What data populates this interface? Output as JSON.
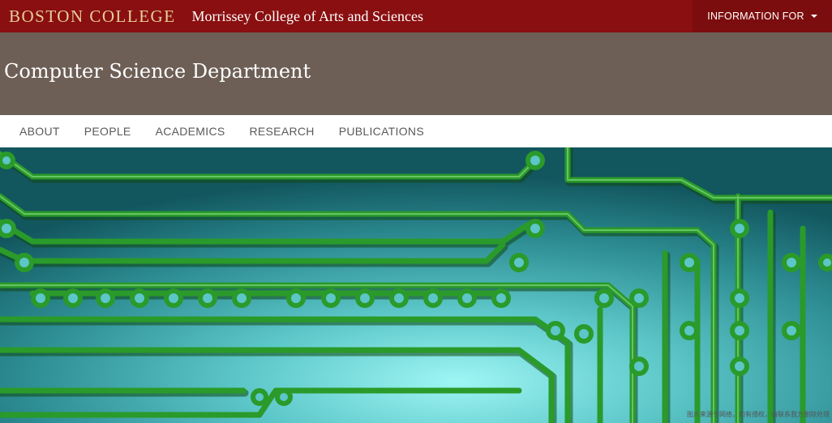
{
  "header": {
    "logo_text": "BOSTON COLLEGE",
    "college_name": "Morrissey College of Arts and Sciences",
    "info_for_label": "INFORMATION FOR"
  },
  "banner": {
    "title": "Computer Science Department"
  },
  "nav": {
    "items": [
      "ABOUT",
      "PEOPLE",
      "ACADEMICS",
      "RESEARCH",
      "PUBLICATIONS"
    ]
  },
  "hero": {
    "caption": "图片来源于网络，如有侵权，请联系我方删除处理"
  },
  "colors": {
    "brand": "#8a0f10",
    "banner": "#6d5f56",
    "logo_gold": "#e6cf9a",
    "trace_green": "#2a9a2a"
  }
}
